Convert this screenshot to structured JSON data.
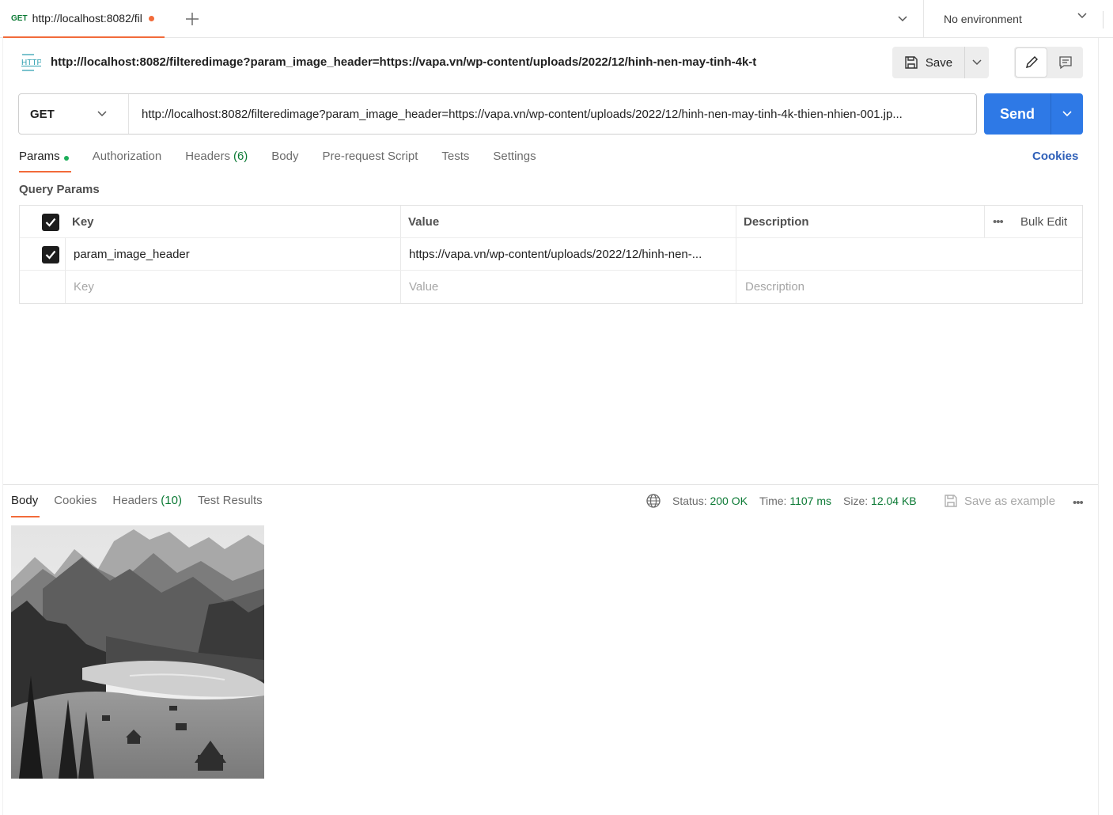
{
  "tab": {
    "method": "GET",
    "title": "http://localhost:8082/fil",
    "unsaved_indicator_color": "#f26b3a"
  },
  "environment": {
    "label": "No environment"
  },
  "request": {
    "icon_text": "HTTP",
    "title": "http://localhost:8082/filteredimage?param_image_header=https://vapa.vn/wp-content/uploads/2022/12/hinh-nen-may-tinh-4k-t",
    "method": "GET",
    "url": "http://localhost:8082/filteredimage?param_image_header=https://vapa.vn/wp-content/uploads/2022/12/hinh-nen-may-tinh-4k-thien-nhien-001.jp..."
  },
  "toolbar": {
    "save_label": "Save",
    "send_label": "Send"
  },
  "request_tabs": {
    "params": "Params",
    "authorization": "Authorization",
    "headers": "Headers",
    "headers_count": "(6)",
    "body": "Body",
    "pre_request": "Pre-request Script",
    "tests": "Tests",
    "settings": "Settings",
    "cookies": "Cookies"
  },
  "query_params": {
    "title": "Query Params",
    "columns": {
      "key": "Key",
      "value": "Value",
      "description": "Description",
      "bulk_edit": "Bulk Edit"
    },
    "rows": [
      {
        "checked": true,
        "key": "param_image_header",
        "value": "https://vapa.vn/wp-content/uploads/2022/12/hinh-nen-...",
        "description": ""
      }
    ],
    "new_row": {
      "key": "Key",
      "value": "Value",
      "description": "Description"
    }
  },
  "response": {
    "tabs": {
      "body": "Body",
      "cookies": "Cookies",
      "headers": "Headers",
      "headers_count": "(10)",
      "test_results": "Test Results"
    },
    "status_label": "Status:",
    "status_value": "200 OK",
    "time_label": "Time:",
    "time_value": "1107 ms",
    "size_label": "Size:",
    "size_value": "12.04 KB",
    "save_example": "Save as example"
  },
  "colors": {
    "accent_orange": "#f26b3a",
    "send_blue": "#2e79e6",
    "success_green": "#0c7a35",
    "link_blue": "#2e5fb8"
  }
}
